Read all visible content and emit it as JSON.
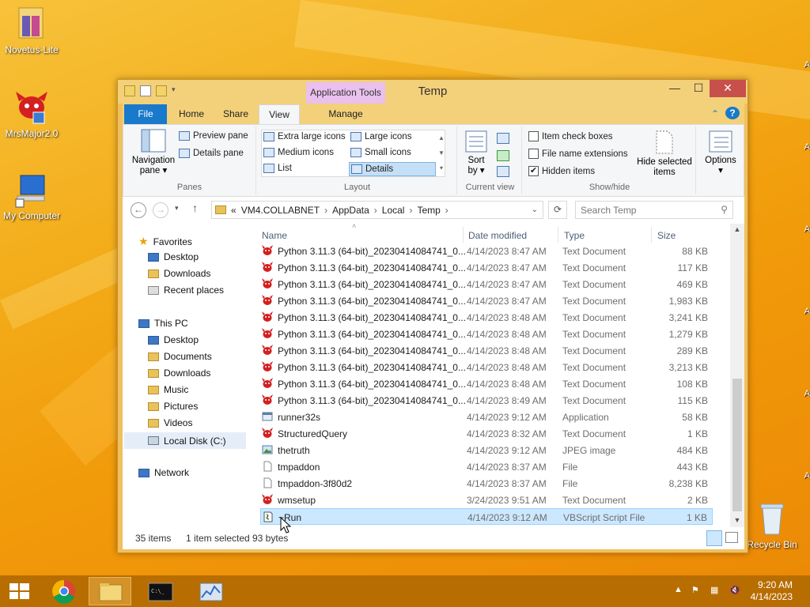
{
  "desktop": {
    "icons": [
      {
        "label": "Novetus-Lite",
        "icon": "folder-icon"
      },
      {
        "label": "MrsMajor2.0",
        "icon": "red-creature-icon"
      },
      {
        "label": "My Computer",
        "icon": "computer-icon"
      },
      {
        "label": "Recycle Bin",
        "icon": "recycle-bin-icon"
      }
    ],
    "edge_letter": "A"
  },
  "window": {
    "title": "Temp",
    "contextual_tab_group": "Application Tools",
    "controls": {
      "minimize": "—",
      "maximize": "☐",
      "close": "✕"
    },
    "tabs": [
      "File",
      "Home",
      "Share",
      "View",
      "Manage"
    ],
    "active_tab": "View",
    "ribbon": {
      "panes": {
        "navigation_pane": "Navigation",
        "navigation_pane_2": "pane ▾",
        "preview_pane": "Preview pane",
        "details_pane": "Details pane",
        "label": "Panes"
      },
      "layout": {
        "items": [
          "Extra large icons",
          "Large icons",
          "Medium icons",
          "Small icons",
          "List",
          "Details"
        ],
        "selected": "Details",
        "label": "Layout"
      },
      "current_view": {
        "sort_by": "Sort",
        "sort_by_2": "by ▾",
        "label": "Current view"
      },
      "show_hide": {
        "item_check_boxes": "Item check boxes",
        "file_name_extensions": "File name extensions",
        "hidden_items": "Hidden items",
        "hidden_items_checked": true,
        "hide_selected": "Hide selected",
        "hide_selected_2": "items",
        "label": "Show/hide"
      },
      "options": "Options"
    },
    "address": {
      "crumbs": [
        "«",
        "VM4.COLLABNET",
        "AppData",
        "Local",
        "Temp"
      ],
      "search_placeholder": "Search Temp"
    },
    "nav_pane": {
      "favorites": "Favorites",
      "fav_items": [
        "Desktop",
        "Downloads",
        "Recent places"
      ],
      "this_pc": "This PC",
      "pc_items": [
        "Desktop",
        "Documents",
        "Downloads",
        "Music",
        "Pictures",
        "Videos",
        "Local Disk (C:)"
      ],
      "selected": "Local Disk (C:)",
      "network": "Network"
    },
    "columns": {
      "name": "Name",
      "date": "Date modified",
      "type": "Type",
      "size": "Size"
    },
    "files": [
      {
        "name": "Python 3.11.3 (64-bit)_20230414084741_0...",
        "date": "4/14/2023 8:47 AM",
        "type": "Text Document",
        "size": "88 KB",
        "icon": "red-creature-icon"
      },
      {
        "name": "Python 3.11.3 (64-bit)_20230414084741_0...",
        "date": "4/14/2023 8:47 AM",
        "type": "Text Document",
        "size": "117 KB",
        "icon": "red-creature-icon"
      },
      {
        "name": "Python 3.11.3 (64-bit)_20230414084741_0...",
        "date": "4/14/2023 8:47 AM",
        "type": "Text Document",
        "size": "469 KB",
        "icon": "red-creature-icon"
      },
      {
        "name": "Python 3.11.3 (64-bit)_20230414084741_0...",
        "date": "4/14/2023 8:47 AM",
        "type": "Text Document",
        "size": "1,983 KB",
        "icon": "red-creature-icon"
      },
      {
        "name": "Python 3.11.3 (64-bit)_20230414084741_0...",
        "date": "4/14/2023 8:48 AM",
        "type": "Text Document",
        "size": "3,241 KB",
        "icon": "red-creature-icon"
      },
      {
        "name": "Python 3.11.3 (64-bit)_20230414084741_0...",
        "date": "4/14/2023 8:48 AM",
        "type": "Text Document",
        "size": "1,279 KB",
        "icon": "red-creature-icon"
      },
      {
        "name": "Python 3.11.3 (64-bit)_20230414084741_0...",
        "date": "4/14/2023 8:48 AM",
        "type": "Text Document",
        "size": "289 KB",
        "icon": "red-creature-icon"
      },
      {
        "name": "Python 3.11.3 (64-bit)_20230414084741_0...",
        "date": "4/14/2023 8:48 AM",
        "type": "Text Document",
        "size": "3,213 KB",
        "icon": "red-creature-icon"
      },
      {
        "name": "Python 3.11.3 (64-bit)_20230414084741_0...",
        "date": "4/14/2023 8:48 AM",
        "type": "Text Document",
        "size": "108 KB",
        "icon": "red-creature-icon"
      },
      {
        "name": "Python 3.11.3 (64-bit)_20230414084741_0...",
        "date": "4/14/2023 8:49 AM",
        "type": "Text Document",
        "size": "115 KB",
        "icon": "red-creature-icon"
      },
      {
        "name": "runner32s",
        "date": "4/14/2023 9:12 AM",
        "type": "Application",
        "size": "58 KB",
        "icon": "application-icon"
      },
      {
        "name": "StructuredQuery",
        "date": "4/14/2023 8:32 AM",
        "type": "Text Document",
        "size": "1 KB",
        "icon": "red-creature-icon"
      },
      {
        "name": "thetruth",
        "date": "4/14/2023 9:12 AM",
        "type": "JPEG image",
        "size": "484 KB",
        "icon": "image-icon"
      },
      {
        "name": "tmpaddon",
        "date": "4/14/2023 8:37 AM",
        "type": "File",
        "size": "443 KB",
        "icon": "blank-file-icon"
      },
      {
        "name": "tmpaddon-3f80d2",
        "date": "4/14/2023 8:37 AM",
        "type": "File",
        "size": "8,238 KB",
        "icon": "blank-file-icon"
      },
      {
        "name": "wmsetup",
        "date": "3/24/2023 9:51 AM",
        "type": "Text Document",
        "size": "2 KB",
        "icon": "red-creature-icon"
      },
      {
        "name": "~Run",
        "date": "4/14/2023 9:12 AM",
        "type": "VBScript Script File",
        "size": "1 KB",
        "icon": "vbscript-icon",
        "selected": true
      }
    ],
    "status": {
      "items": "35 items",
      "selected": "1 item selected",
      "bytes": "93 bytes"
    }
  },
  "taskbar": {
    "apps": [
      "chrome-icon",
      "file-explorer-icon",
      "command-prompt-icon",
      "resource-monitor-icon"
    ],
    "clock_time": "9:20 AM",
    "clock_date": "4/14/2023"
  },
  "colors": {
    "accent": "#1979ca",
    "selection": "#cce8ff",
    "taskbar": "#b86d00",
    "desktop": "#f3ab18",
    "close": "#c7504b"
  }
}
